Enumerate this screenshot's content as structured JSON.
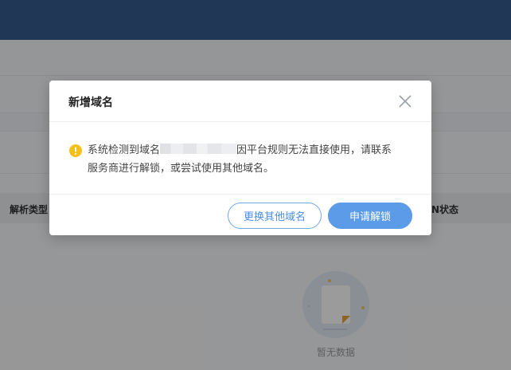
{
  "page": {
    "table_headers": {
      "left": "解析类型",
      "right": "DN状态"
    },
    "empty_text": "暂无数据"
  },
  "dialog": {
    "title": "新增域名",
    "message_prefix": "系统检测到域名",
    "message_suffix": "因平台规则无法直接使用，请联系",
    "message_line2": "服务商进行解锁，或尝试使用其他域名。",
    "buttons": {
      "change_domain": "更换其他域名",
      "request_unlock": "申请解锁"
    },
    "icons": {
      "warning": "warning-circle-icon",
      "close": "close-icon"
    }
  },
  "colors": {
    "header_bar": "#36598c",
    "primary": "#5b9be8",
    "warning": "#f5c018"
  }
}
